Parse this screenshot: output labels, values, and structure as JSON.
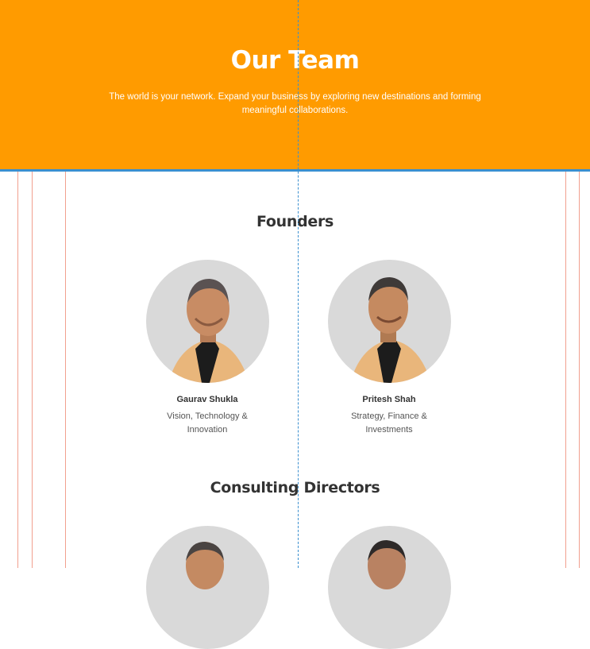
{
  "hero": {
    "title": "Our Team",
    "subtitle_line1": "The world is your network. Expand your business by exploring new destinations and forming",
    "subtitle_line2": "meaningful collaborations."
  },
  "founders": {
    "heading": "Founders",
    "members": [
      {
        "name": "Gaurav Shukla",
        "role_line1": "Vision, Technology &",
        "role_line2": "Innovation"
      },
      {
        "name": "Pritesh Shah",
        "role_line1": "Strategy, Finance &",
        "role_line2": "Investments"
      }
    ]
  },
  "directors": {
    "heading": "Consulting Directors"
  },
  "colors": {
    "hero_background": "#ff9b00",
    "hero_border": "#3a8fcf",
    "photo_background": "#d9d9d9",
    "guide_line": "#f1a08f"
  }
}
